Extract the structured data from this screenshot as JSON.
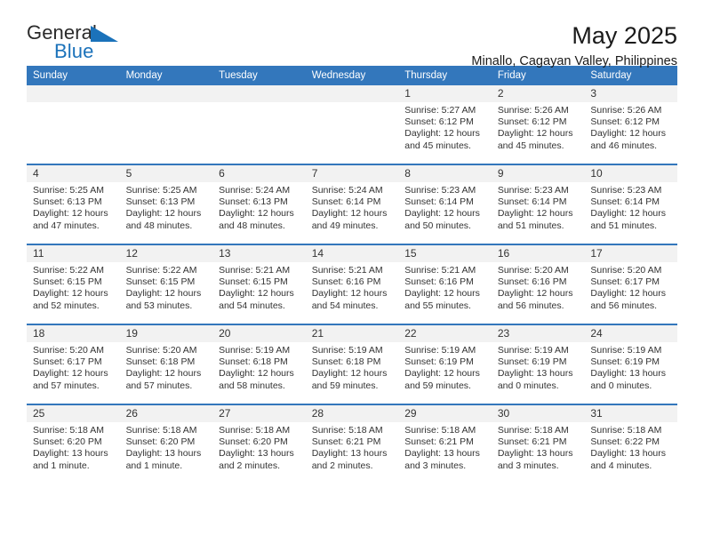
{
  "brand": {
    "name_part1": "General",
    "name_part2": "Blue"
  },
  "header": {
    "title": "May 2025",
    "location": "Minallo, Cagayan Valley, Philippines"
  },
  "colors": {
    "header_blue": "#3377bc",
    "logo_blue": "#1b72ba",
    "daynum_band": "#f2f2f2",
    "text": "#333333"
  },
  "weekday_headers": [
    "Sunday",
    "Monday",
    "Tuesday",
    "Wednesday",
    "Thursday",
    "Friday",
    "Saturday"
  ],
  "weeks": [
    [
      {
        "day": "",
        "empty": true,
        "sunrise": "",
        "sunset": "",
        "daylight": ""
      },
      {
        "day": "",
        "empty": true,
        "sunrise": "",
        "sunset": "",
        "daylight": ""
      },
      {
        "day": "",
        "empty": true,
        "sunrise": "",
        "sunset": "",
        "daylight": ""
      },
      {
        "day": "",
        "empty": true,
        "sunrise": "",
        "sunset": "",
        "daylight": ""
      },
      {
        "day": "1",
        "empty": false,
        "sunrise": "Sunrise: 5:27 AM",
        "sunset": "Sunset: 6:12 PM",
        "daylight": "Daylight: 12 hours and 45 minutes."
      },
      {
        "day": "2",
        "empty": false,
        "sunrise": "Sunrise: 5:26 AM",
        "sunset": "Sunset: 6:12 PM",
        "daylight": "Daylight: 12 hours and 45 minutes."
      },
      {
        "day": "3",
        "empty": false,
        "sunrise": "Sunrise: 5:26 AM",
        "sunset": "Sunset: 6:12 PM",
        "daylight": "Daylight: 12 hours and 46 minutes."
      }
    ],
    [
      {
        "day": "4",
        "empty": false,
        "sunrise": "Sunrise: 5:25 AM",
        "sunset": "Sunset: 6:13 PM",
        "daylight": "Daylight: 12 hours and 47 minutes."
      },
      {
        "day": "5",
        "empty": false,
        "sunrise": "Sunrise: 5:25 AM",
        "sunset": "Sunset: 6:13 PM",
        "daylight": "Daylight: 12 hours and 48 minutes."
      },
      {
        "day": "6",
        "empty": false,
        "sunrise": "Sunrise: 5:24 AM",
        "sunset": "Sunset: 6:13 PM",
        "daylight": "Daylight: 12 hours and 48 minutes."
      },
      {
        "day": "7",
        "empty": false,
        "sunrise": "Sunrise: 5:24 AM",
        "sunset": "Sunset: 6:14 PM",
        "daylight": "Daylight: 12 hours and 49 minutes."
      },
      {
        "day": "8",
        "empty": false,
        "sunrise": "Sunrise: 5:23 AM",
        "sunset": "Sunset: 6:14 PM",
        "daylight": "Daylight: 12 hours and 50 minutes."
      },
      {
        "day": "9",
        "empty": false,
        "sunrise": "Sunrise: 5:23 AM",
        "sunset": "Sunset: 6:14 PM",
        "daylight": "Daylight: 12 hours and 51 minutes."
      },
      {
        "day": "10",
        "empty": false,
        "sunrise": "Sunrise: 5:23 AM",
        "sunset": "Sunset: 6:14 PM",
        "daylight": "Daylight: 12 hours and 51 minutes."
      }
    ],
    [
      {
        "day": "11",
        "empty": false,
        "sunrise": "Sunrise: 5:22 AM",
        "sunset": "Sunset: 6:15 PM",
        "daylight": "Daylight: 12 hours and 52 minutes."
      },
      {
        "day": "12",
        "empty": false,
        "sunrise": "Sunrise: 5:22 AM",
        "sunset": "Sunset: 6:15 PM",
        "daylight": "Daylight: 12 hours and 53 minutes."
      },
      {
        "day": "13",
        "empty": false,
        "sunrise": "Sunrise: 5:21 AM",
        "sunset": "Sunset: 6:15 PM",
        "daylight": "Daylight: 12 hours and 54 minutes."
      },
      {
        "day": "14",
        "empty": false,
        "sunrise": "Sunrise: 5:21 AM",
        "sunset": "Sunset: 6:16 PM",
        "daylight": "Daylight: 12 hours and 54 minutes."
      },
      {
        "day": "15",
        "empty": false,
        "sunrise": "Sunrise: 5:21 AM",
        "sunset": "Sunset: 6:16 PM",
        "daylight": "Daylight: 12 hours and 55 minutes."
      },
      {
        "day": "16",
        "empty": false,
        "sunrise": "Sunrise: 5:20 AM",
        "sunset": "Sunset: 6:16 PM",
        "daylight": "Daylight: 12 hours and 56 minutes."
      },
      {
        "day": "17",
        "empty": false,
        "sunrise": "Sunrise: 5:20 AM",
        "sunset": "Sunset: 6:17 PM",
        "daylight": "Daylight: 12 hours and 56 minutes."
      }
    ],
    [
      {
        "day": "18",
        "empty": false,
        "sunrise": "Sunrise: 5:20 AM",
        "sunset": "Sunset: 6:17 PM",
        "daylight": "Daylight: 12 hours and 57 minutes."
      },
      {
        "day": "19",
        "empty": false,
        "sunrise": "Sunrise: 5:20 AM",
        "sunset": "Sunset: 6:18 PM",
        "daylight": "Daylight: 12 hours and 57 minutes."
      },
      {
        "day": "20",
        "empty": false,
        "sunrise": "Sunrise: 5:19 AM",
        "sunset": "Sunset: 6:18 PM",
        "daylight": "Daylight: 12 hours and 58 minutes."
      },
      {
        "day": "21",
        "empty": false,
        "sunrise": "Sunrise: 5:19 AM",
        "sunset": "Sunset: 6:18 PM",
        "daylight": "Daylight: 12 hours and 59 minutes."
      },
      {
        "day": "22",
        "empty": false,
        "sunrise": "Sunrise: 5:19 AM",
        "sunset": "Sunset: 6:19 PM",
        "daylight": "Daylight: 12 hours and 59 minutes."
      },
      {
        "day": "23",
        "empty": false,
        "sunrise": "Sunrise: 5:19 AM",
        "sunset": "Sunset: 6:19 PM",
        "daylight": "Daylight: 13 hours and 0 minutes."
      },
      {
        "day": "24",
        "empty": false,
        "sunrise": "Sunrise: 5:19 AM",
        "sunset": "Sunset: 6:19 PM",
        "daylight": "Daylight: 13 hours and 0 minutes."
      }
    ],
    [
      {
        "day": "25",
        "empty": false,
        "sunrise": "Sunrise: 5:18 AM",
        "sunset": "Sunset: 6:20 PM",
        "daylight": "Daylight: 13 hours and 1 minute."
      },
      {
        "day": "26",
        "empty": false,
        "sunrise": "Sunrise: 5:18 AM",
        "sunset": "Sunset: 6:20 PM",
        "daylight": "Daylight: 13 hours and 1 minute."
      },
      {
        "day": "27",
        "empty": false,
        "sunrise": "Sunrise: 5:18 AM",
        "sunset": "Sunset: 6:20 PM",
        "daylight": "Daylight: 13 hours and 2 minutes."
      },
      {
        "day": "28",
        "empty": false,
        "sunrise": "Sunrise: 5:18 AM",
        "sunset": "Sunset: 6:21 PM",
        "daylight": "Daylight: 13 hours and 2 minutes."
      },
      {
        "day": "29",
        "empty": false,
        "sunrise": "Sunrise: 5:18 AM",
        "sunset": "Sunset: 6:21 PM",
        "daylight": "Daylight: 13 hours and 3 minutes."
      },
      {
        "day": "30",
        "empty": false,
        "sunrise": "Sunrise: 5:18 AM",
        "sunset": "Sunset: 6:21 PM",
        "daylight": "Daylight: 13 hours and 3 minutes."
      },
      {
        "day": "31",
        "empty": false,
        "sunrise": "Sunrise: 5:18 AM",
        "sunset": "Sunset: 6:22 PM",
        "daylight": "Daylight: 13 hours and 4 minutes."
      }
    ]
  ]
}
